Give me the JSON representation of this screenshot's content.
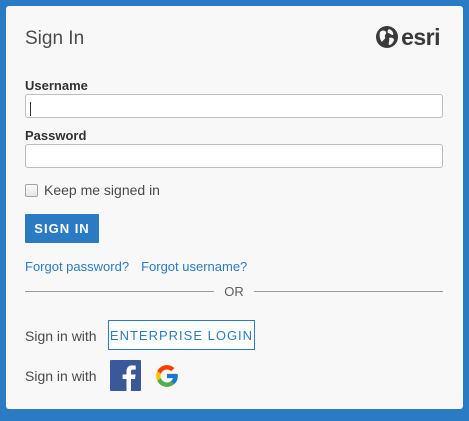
{
  "header": {
    "title": "Sign In",
    "logo_text": "esri"
  },
  "form": {
    "username_label": "Username",
    "username_value": "",
    "password_label": "Password",
    "password_value": "",
    "keep_signed_in_label": "Keep me signed in",
    "keep_signed_in_checked": false,
    "sign_in_button": "SIGN IN"
  },
  "links": {
    "forgot_password": "Forgot password?",
    "forgot_username": "Forgot username?"
  },
  "divider": {
    "text": "OR"
  },
  "enterprise": {
    "label": "Sign in with",
    "button": "ENTERPRISE LOGIN"
  },
  "social": {
    "label": "Sign in with",
    "providers": [
      "facebook-icon",
      "google-icon"
    ]
  },
  "colors": {
    "accent": "#2a7bc4",
    "facebook": "#3b5998",
    "background": "#f8f8f8"
  }
}
